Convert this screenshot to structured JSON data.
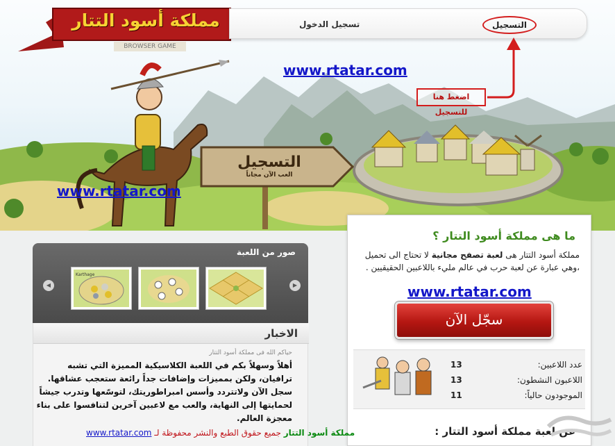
{
  "header": {
    "logo_text": "مملكة أسود التتار",
    "logo_tag": "BROWSER GAME",
    "nav_login": "تسجيل الدخول",
    "nav_register": "التسجيل"
  },
  "hero": {
    "url_top": "www.rtatar.com",
    "url_left": "www.rtatar.com",
    "click_here": "اضغط هنا للتسجيل",
    "sign_title": "التسجيل",
    "sign_sub": "العب الآن مجاناً"
  },
  "whatis": {
    "title": "ما هى مملكة أسود التتار ؟",
    "body_prefix": "مملكة أسود التتار هى ",
    "body_bold": "لعبة تصفح مجانية",
    "body_rest": " لا تحتاج الى تحميل ،وهي عبارة عن لعبة حرب في عالم مليء باللاعبين الحقيقيين .",
    "url": "www.rtatar.com",
    "register_button": "سجّل الآن",
    "stats": [
      {
        "label": "عدد اللاعبين:",
        "value": "13"
      },
      {
        "label": "اللاعبون النشطون:",
        "value": "13"
      },
      {
        "label": "الموجودون حالياً:",
        "value": "11"
      }
    ],
    "footer_heading": "عن لعبة مملكة أسود التتار :"
  },
  "gallery": {
    "title": "صور من اللعبة",
    "thumb_caption": "Karthage"
  },
  "news": {
    "title": "الاخبار",
    "greeting": "حياكم الله فى مملكة أسود التتار",
    "body": "أهلاً وسهلاً بكم في اللعبة الكلاسيكية المميزة التي تشبه ترافيان، ولكن بمميزات وإضافات جداً رائعة ستعجب عشاقها. سجل الآن ولاتتردد وأسس امبراطوريتك، لتوسّعها وتدرب جيشاً لحمايتها إلى النهاية، والعب مع لاعبين آخرين لتنافسوا على بناء معجزة العالم."
  },
  "footer": {
    "url": "www.rtatar.com",
    "copyright": "جميع حقوق الطبع والنشر محفوظة لـ",
    "site_name": "مملكة أسود التتار"
  },
  "colors": {
    "accent_red": "#c0141a",
    "link_blue": "#1417c9",
    "title_green": "#3f8b1f"
  }
}
